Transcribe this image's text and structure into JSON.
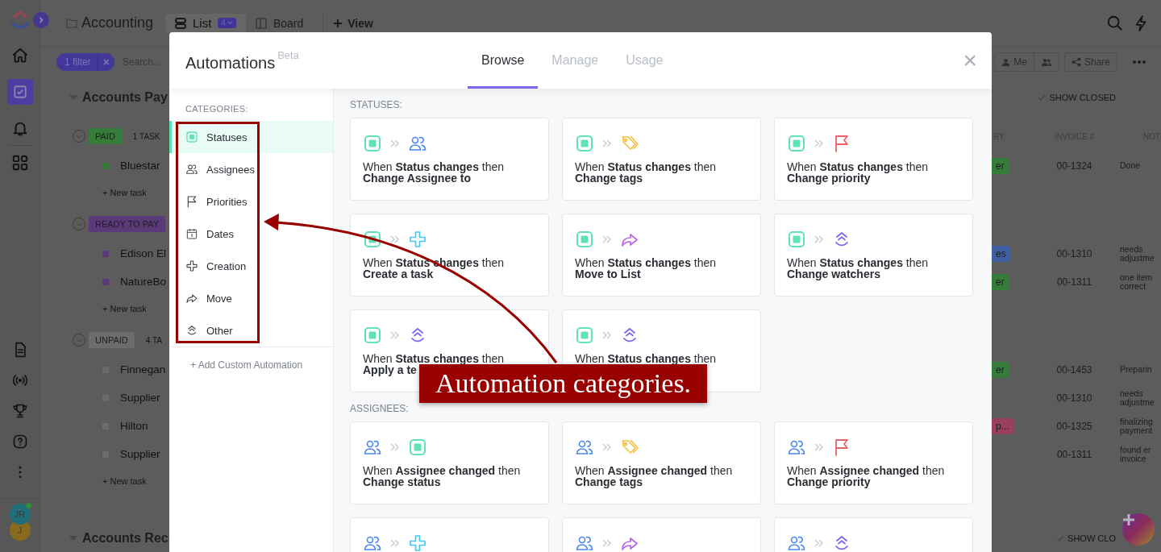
{
  "rail": {
    "avatars": [
      {
        "initials": "JR",
        "color": "#1f6f7a",
        "online": true
      },
      {
        "initials": "J",
        "color": "#8a6a1c",
        "online": false
      }
    ]
  },
  "topbar": {
    "breadcrumb": "Accounting",
    "views": [
      {
        "label": "List",
        "count": "4",
        "selected": true
      },
      {
        "label": "Board",
        "selected": false
      }
    ],
    "add_view": "View"
  },
  "filter_bar": {
    "filter": "1 filter",
    "clear": "×",
    "search_placeholder": "Search...",
    "me": "Me",
    "share": "Share"
  },
  "list": {
    "sections": [
      {
        "title": "Accounts Pay",
        "show_closed": "SHOW CLOSED",
        "columns": [
          "RY",
          "INVOICE #",
          "NOT"
        ],
        "groups": [
          {
            "status": "PAID",
            "color": "#367c39",
            "count": "1 TASK",
            "tasks": [
              {
                "name": "Bluestar",
                "tag": {
                  "label": "er",
                  "color": "#367c39"
                },
                "invoice": "00-1324",
                "note": "Done"
              }
            ],
            "new_task": "+ New task"
          },
          {
            "status": "READY TO PAY",
            "color": "#5b3a7a",
            "tasks": [
              {
                "name": "Edison El",
                "tag": {
                  "label": "es",
                  "color": "#3f5fa0"
                },
                "invoice": "00-1310",
                "note": "needs adjustme"
              },
              {
                "name": "NatureBo",
                "tag": {
                  "label": "er",
                  "color": "#367c39"
                },
                "invoice": "00-1311",
                "note": "one item correct"
              }
            ],
            "new_task": "+ New task"
          },
          {
            "status": "UNPAID",
            "color": "#6c6c6c",
            "count": "4 TA",
            "tasks": [
              {
                "name": "Finnegan",
                "tag": {
                  "label": "er",
                  "color": "#367c39"
                },
                "invoice": "00-1453",
                "note": "Preparin"
              },
              {
                "name": "Supplier",
                "invoice": "00-1310",
                "note": "needs adjustme"
              },
              {
                "name": "Hilton",
                "tag": {
                  "label": "p...",
                  "color": "#9b3f5f"
                },
                "invoice": "00-1325",
                "note": "finalizing payment"
              },
              {
                "name": "Supplier",
                "invoice": "00-1311",
                "note": "found er invoice"
              }
            ],
            "new_task": "+ New task"
          }
        ]
      },
      {
        "title": "Accounts Rec",
        "show_closed": "SHOW CLO"
      }
    ]
  },
  "modal": {
    "title": "Automations",
    "badge": "Beta",
    "tabs": [
      {
        "label": "Browse",
        "selected": true
      },
      {
        "label": "Manage",
        "selected": false
      },
      {
        "label": "Usage",
        "selected": false
      }
    ],
    "close": "×",
    "categories_label": "CATEGORIES:",
    "categories": [
      {
        "label": "Statuses",
        "kind": "status",
        "selected": true
      },
      {
        "label": "Assignees",
        "kind": "people",
        "selected": false
      },
      {
        "label": "Priorities",
        "kind": "flag",
        "selected": false
      },
      {
        "label": "Dates",
        "kind": "date",
        "selected": false
      },
      {
        "label": "Creation",
        "kind": "plus",
        "selected": false
      },
      {
        "label": "Move",
        "kind": "move",
        "selected": false
      },
      {
        "label": "Other",
        "kind": "watchers",
        "selected": false
      }
    ],
    "add_custom": "+ Add Custom Automation",
    "sections": [
      {
        "title": "STATUSES:",
        "cards": [
          {
            "icons": [
              {
                "kind": "status"
              },
              {
                "kind": "people"
              }
            ],
            "text": "When **Status changes** then",
            "result": "Change Assignee to"
          },
          {
            "icons": [
              {
                "kind": "status"
              },
              {
                "kind": "tag"
              }
            ],
            "text": "When **Status changes** then",
            "result": "Change tags"
          },
          {
            "icons": [
              {
                "kind": "status"
              },
              {
                "kind": "flag"
              }
            ],
            "text": "When **Status changes** then",
            "result": "Change priority"
          },
          {
            "icons": [
              {
                "kind": "status"
              },
              {
                "kind": "plus"
              }
            ],
            "text": "When **Status changes** then",
            "result": "Create a task"
          },
          {
            "icons": [
              {
                "kind": "status"
              },
              {
                "kind": "move"
              }
            ],
            "text": "When **Status changes** then",
            "result": "Move to List"
          },
          {
            "icons": [
              {
                "kind": "status"
              },
              {
                "kind": "watchers"
              }
            ],
            "text": "When **Status changes** then",
            "result": "Change watchers"
          },
          {
            "icons": [
              {
                "kind": "status"
              },
              {
                "kind": "watchers"
              }
            ],
            "text": "When **Status changes** then",
            "result": "Apply a te"
          },
          {
            "icons": [
              {
                "kind": "status"
              },
              {
                "kind": "watchers"
              }
            ],
            "text": "When **Status changes** then"
          }
        ]
      },
      {
        "title": "ASSIGNEES:",
        "cards": [
          {
            "icons": [
              {
                "kind": "people"
              },
              {
                "kind": "status"
              }
            ],
            "text": "When **Assignee changed** then",
            "result": "Change status"
          },
          {
            "icons": [
              {
                "kind": "people"
              },
              {
                "kind": "tag"
              }
            ],
            "text": "When **Assignee changed** then",
            "result": "Change tags"
          },
          {
            "icons": [
              {
                "kind": "people"
              },
              {
                "kind": "flag"
              }
            ],
            "text": "When **Assignee changed** then",
            "result": "Change priority"
          },
          {
            "icons": [
              {
                "kind": "people"
              },
              {
                "kind": "plus"
              }
            ]
          },
          {
            "icons": [
              {
                "kind": "people"
              },
              {
                "kind": "move"
              }
            ]
          },
          {
            "icons": [
              {
                "kind": "people"
              },
              {
                "kind": "watchers"
              }
            ]
          }
        ]
      }
    ]
  },
  "annotation": {
    "label": "Automation categories."
  }
}
